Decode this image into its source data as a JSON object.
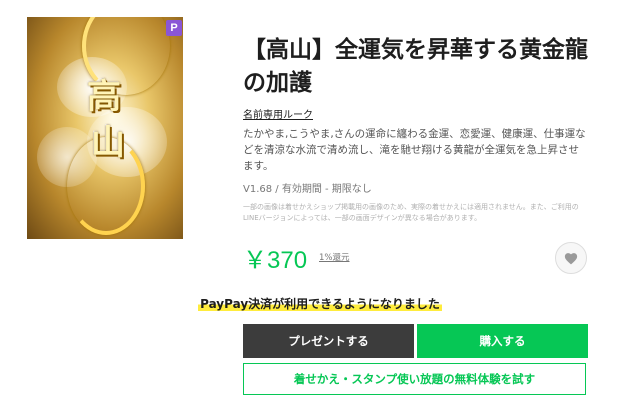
{
  "product": {
    "badge": "P",
    "thumb_chars": [
      "高",
      "山"
    ],
    "title": "【高山】全運気を昇華する黄金龍の加護",
    "author": "名前専用ルーク",
    "description": "たかやま,こうやま,さんの運命に纏わる金運、恋愛運、健康運、仕事運などを清涼な水流で清め流し、滝を馳せ翔ける黄龍が全運気を急上昇させます。",
    "version": "V1.68 / 有効期間 - 期限なし",
    "notice": "一部の画像は着せかえショップ掲載用の画像のため、実際の着せかえには適用されません。また、ご利用のLINEバージョンによっては、一部の画面デザインが異なる場合があります。",
    "price": "￥370",
    "reward": "1%還元"
  },
  "actions": {
    "paypay_notice": "PayPay決済が利用できるようになりました",
    "gift_label": "プレゼントする",
    "buy_label": "購入する",
    "trial_label": "着せかえ・スタンプ使い放題の無料体験を試す"
  },
  "icons": {
    "favorite": "heart-icon"
  },
  "colors": {
    "accent": "#06c755",
    "dark_button": "#3c3c3c",
    "badge": "#8a56d6",
    "highlight": "#ffec3d"
  }
}
